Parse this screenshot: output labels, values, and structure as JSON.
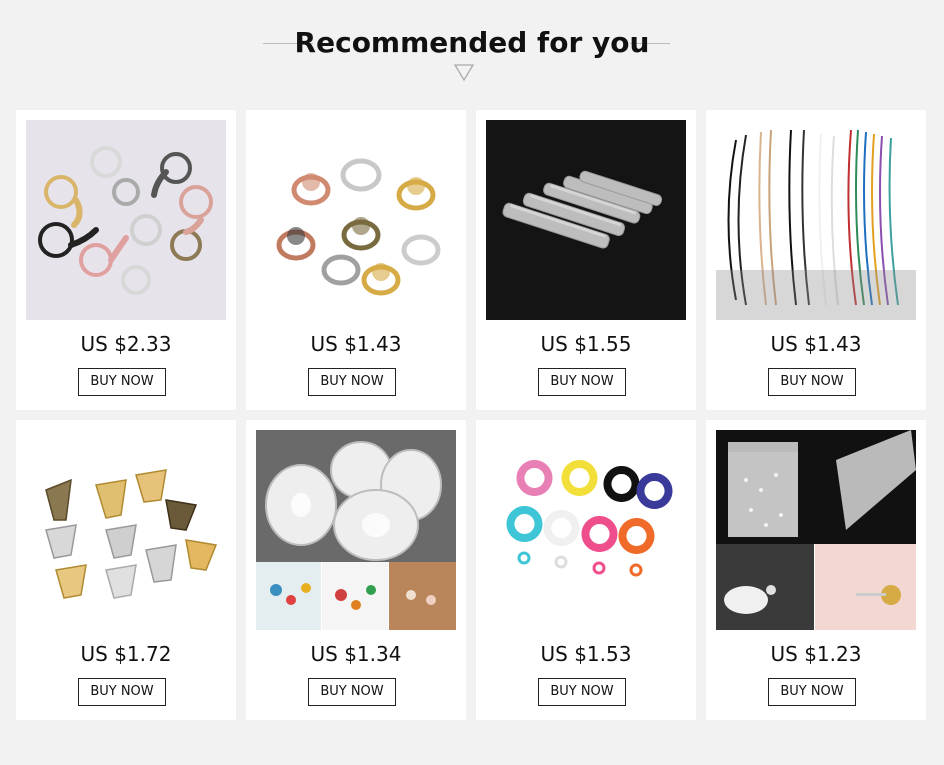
{
  "header": {
    "title": "Recommended for you"
  },
  "products": [
    {
      "price": "US $2.33",
      "buy_label": "BUY NOW",
      "image": "keychain-rings-image"
    },
    {
      "price": "US $1.43",
      "buy_label": "BUY NOW",
      "image": "ring-base-blanks-image"
    },
    {
      "price": "US $1.55",
      "buy_label": "BUY NOW",
      "image": "hair-clip-blanks-image"
    },
    {
      "price": "US $1.43",
      "buy_label": "BUY NOW",
      "image": "wax-cord-necklaces-image"
    },
    {
      "price": "US $1.72",
      "buy_label": "BUY NOW",
      "image": "filigree-bead-caps-image"
    },
    {
      "price": "US $1.34",
      "buy_label": "BUY NOW",
      "image": "elastic-thread-spools-image"
    },
    {
      "price": "US $1.53",
      "buy_label": "BUY NOW",
      "image": "lobster-clasps-image"
    },
    {
      "price": "US $1.23",
      "buy_label": "BUY NOW",
      "image": "earring-stoppers-image"
    }
  ],
  "colors": {
    "background": "#f2f2f2",
    "card": "#ffffff",
    "text": "#111111"
  }
}
